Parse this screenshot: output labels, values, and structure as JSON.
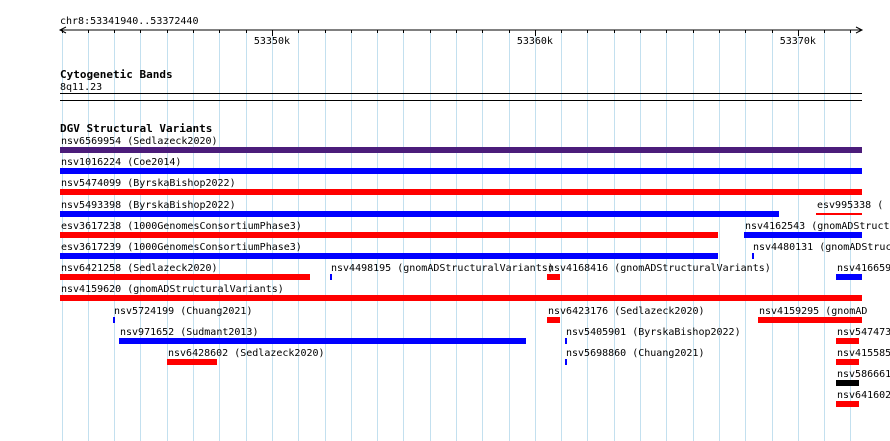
{
  "browser": {
    "coordinate_label": "chr8:53341940..53372440",
    "ruler_ticks": [
      "53350k",
      "53360k",
      "53370k"
    ],
    "colors": {
      "grid": "#c3e0ef",
      "red": "#ff0000",
      "blue": "#0000ff",
      "purple": "#4b1c7a",
      "black": "#000000"
    }
  },
  "tracks": {
    "cytoband": {
      "title": "Cytogenetic Bands",
      "band": "8q11.23"
    },
    "dgv": {
      "title": "DGV Structural Variants",
      "features": [
        {
          "label": "nsv6569954 (Sedlazeck2020)",
          "color": "purple",
          "start": 53341940,
          "end": 53372440,
          "row": 0
        },
        {
          "label": "nsv1016224 (Coe2014)",
          "color": "blue",
          "start": 53341940,
          "end": 53372440,
          "row": 1
        },
        {
          "label": "nsv5474099 (ByrskaBishop2022)",
          "color": "red",
          "start": 53341940,
          "end": 53372440,
          "row": 2
        },
        {
          "label": "nsv5493398 (ByrskaBishop2022)",
          "color": "blue",
          "start": 53341940,
          "end": 53369300,
          "row": 3
        },
        {
          "label": "esv995338 (",
          "color": "red",
          "start": 53370700,
          "end": 53372440,
          "row": 3,
          "thin": true
        },
        {
          "label": "esv3617238 (1000GenomesConsortiumPhase3)",
          "color": "red",
          "start": 53341940,
          "end": 53366970,
          "row": 4
        },
        {
          "label": "nsv4162543 (gnomADStructu",
          "color": "blue",
          "start": 53367960,
          "end": 53372440,
          "row": 4
        },
        {
          "label": "esv3617239 (1000GenomesConsortiumPhase3)",
          "color": "blue",
          "start": 53341940,
          "end": 53366970,
          "row": 5
        },
        {
          "label": "nsv4480131 (gnomADStructu",
          "color": "blue",
          "start": 53368240,
          "end": 53368310,
          "row": 5
        },
        {
          "label": "nsv6421258 (Sedlazeck2020)",
          "color": "red",
          "start": 53341940,
          "end": 53351450,
          "row": 6
        },
        {
          "label": "nsv4498195 (gnomADStructuralVariants)",
          "color": "blue",
          "start": 53352200,
          "end": 53352300,
          "row": 6
        },
        {
          "label": "nsv4168416 (gnomADStructuralVariants)",
          "color": "red",
          "start": 53360450,
          "end": 53360950,
          "row": 6
        },
        {
          "label": "nsv416659",
          "color": "blue",
          "start": 53371440,
          "end": 53372440,
          "row": 6
        },
        {
          "label": "nsv4159620 (gnomADStructuralVariants)",
          "color": "red",
          "start": 53341940,
          "end": 53372440,
          "row": 7
        },
        {
          "label": "nsv5724199 (Chuang2021)",
          "color": "blue",
          "start": 53343960,
          "end": 53344030,
          "row": 8
        },
        {
          "label": "nsv6423176 (Sedlazeck2020)",
          "color": "red",
          "start": 53360450,
          "end": 53360950,
          "row": 8
        },
        {
          "label": "nsv4159295 (gnomAD",
          "color": "red",
          "start": 53368490,
          "end": 53372440,
          "row": 8
        },
        {
          "label": "nsv971652 (Sudmant2013)",
          "color": "blue",
          "start": 53344180,
          "end": 53359680,
          "row": 9
        },
        {
          "label": "nsv5405901 (ByrskaBishop2022)",
          "color": "blue",
          "start": 53361130,
          "end": 53361210,
          "row": 9
        },
        {
          "label": "nsv547473",
          "color": "red",
          "start": 53371470,
          "end": 53372340,
          "row": 9
        },
        {
          "label": "nsv6428602 (Sedlazeck2020)",
          "color": "red",
          "start": 53346000,
          "end": 53347900,
          "row": 10
        },
        {
          "label": "nsv5698860 (Chuang2021)",
          "color": "blue",
          "start": 53361130,
          "end": 53361210,
          "row": 10
        },
        {
          "label": "nsv415585",
          "color": "red",
          "start": 53371470,
          "end": 53372340,
          "row": 10
        },
        {
          "label": "nsv586661",
          "color": "black",
          "start": 53371470,
          "end": 53372340,
          "row": 11
        },
        {
          "label": "nsv641602",
          "color": "red",
          "start": 53371470,
          "end": 53372340,
          "row": 12
        }
      ]
    }
  }
}
